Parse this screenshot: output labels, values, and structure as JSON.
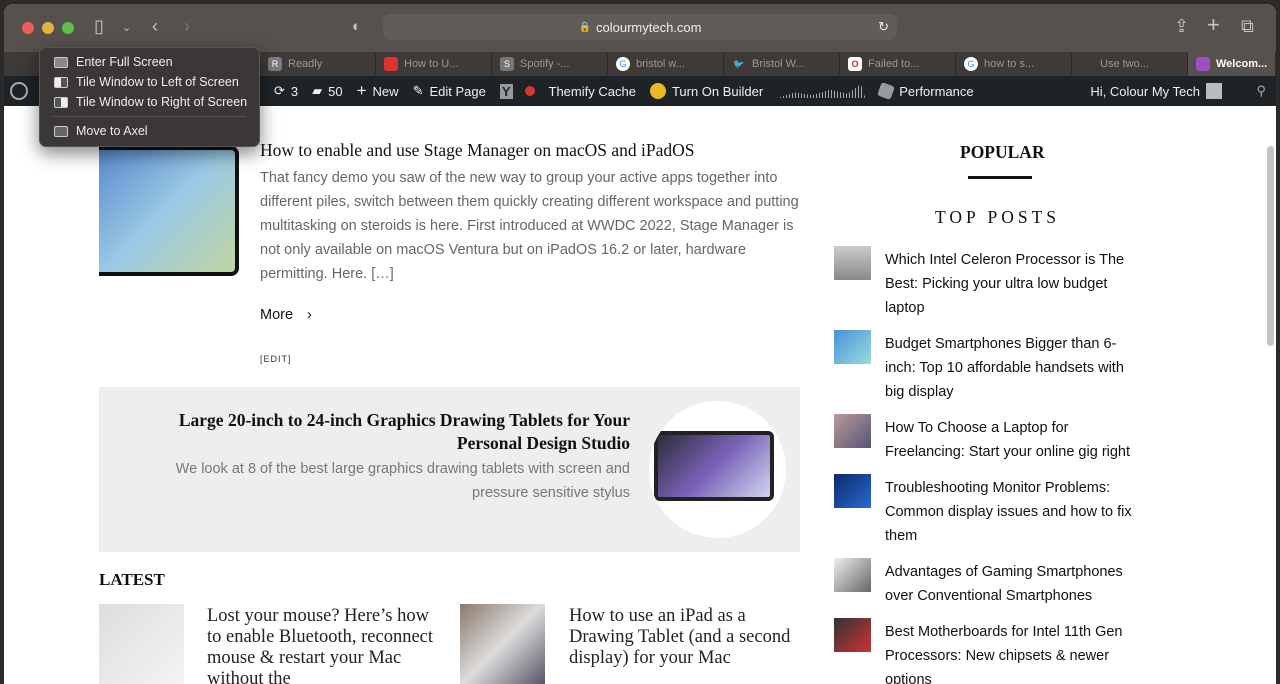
{
  "browser": {
    "url": "colourmytech.com",
    "tabs": [
      {
        "label": "",
        "icon": ""
      },
      {
        "label": "",
        "icon": ""
      },
      {
        "label": "Readly",
        "icon": "R"
      },
      {
        "label": "How to U...",
        "icon": "red"
      },
      {
        "label": "Spotify -...",
        "icon": "S"
      },
      {
        "label": "bristol w...",
        "icon": "G"
      },
      {
        "label": "Bristol W...",
        "icon": "twitter"
      },
      {
        "label": "Failed to...",
        "icon": "O"
      },
      {
        "label": "how to s...",
        "icon": "G"
      },
      {
        "label": "Use two...",
        "icon": "apple"
      },
      {
        "label": "Welcom...",
        "icon": "purple"
      }
    ]
  },
  "window_menu": {
    "items": [
      "Enter Full Screen",
      "Tile Window to Left of Screen",
      "Tile Window to Right of Screen"
    ],
    "move": "Move to Axel"
  },
  "admin_bar": {
    "updates": "3",
    "comments": "50",
    "new": "New",
    "edit": "Edit Page",
    "cache": "Themify Cache",
    "builder": "Turn On Builder",
    "performance": "Performance",
    "greeting": "Hi, Colour My Tech"
  },
  "article": {
    "title": "How to enable and use Stage Manager on macOS and iPadOS",
    "excerpt": "That fancy demo you saw of the new way to group your active apps together into different piles, switch between them quickly creating different workspace and putting multitasking on steroids is here. First introduced at WWDC 2022, Stage Manager is not only available on macOS Ventura but on iPadOS 16.2 or later, hardware permitting. Here. […]",
    "more": "More",
    "edit": "[EDIT]"
  },
  "promo": {
    "title": "Large 20-inch to 24-inch Graphics Drawing Tablets for Your Personal Design Studio",
    "desc": "We look at 8 of the best large graphics drawing tablets with screen and pressure sensitive stylus"
  },
  "latest": {
    "heading": "LATEST",
    "items": [
      "Lost your mouse? Here’s how to enable Bluetooth, reconnect mouse & restart your Mac without the",
      "How to use an iPad as a Drawing Tablet (and a second display) for your Mac"
    ]
  },
  "sidebar": {
    "popular": "POPULAR",
    "top_posts": "TOP POSTS",
    "posts": [
      "Which Intel Celeron Processor is The Best: Picking your ultra low budget laptop",
      "Budget Smartphones Bigger than 6-inch: Top 10 affordable handsets with big display",
      "How To Choose a Laptop for Freelancing: Start your online gig right",
      "Troubleshooting Monitor Problems: Common display issues and how to fix them",
      "Advantages of Gaming Smartphones over Conventional Smartphones",
      "Best Motherboards for Intel 11th Gen Processors: New chipsets & newer options"
    ]
  }
}
